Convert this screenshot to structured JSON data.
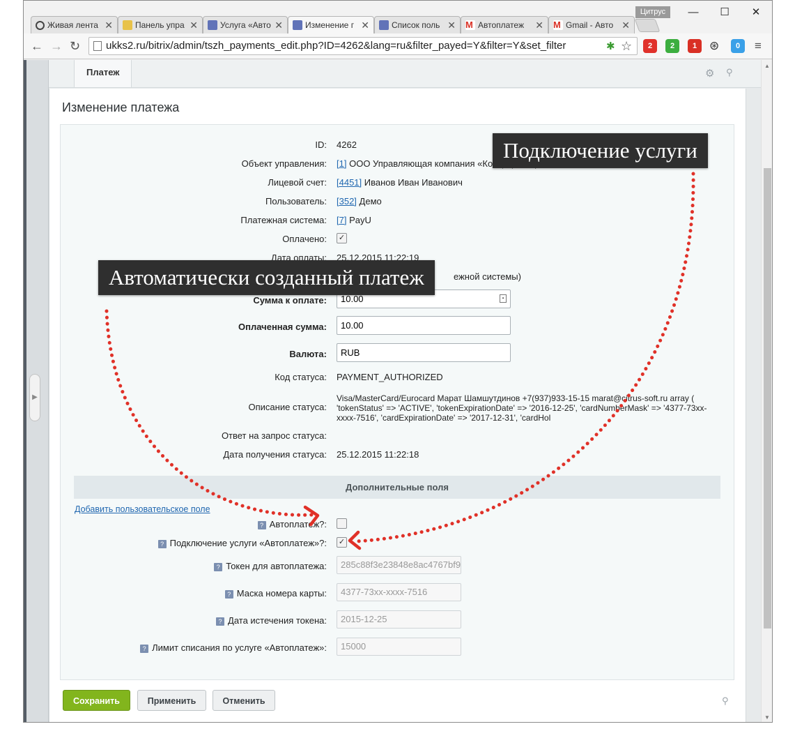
{
  "browser": {
    "profile": "Цитрус",
    "tabs": [
      {
        "label": "Живая лента"
      },
      {
        "label": "Панель упра"
      },
      {
        "label": "Услуга «Авто"
      },
      {
        "label": "Изменение г"
      },
      {
        "label": "Список поль"
      },
      {
        "label": "Автоплатеж"
      },
      {
        "label": "Gmail - Авто"
      }
    ],
    "url": "ukks2.ru/bitrix/admin/tszh_payments_edit.php?ID=4262&lang=ru&filter_payed=Y&filter=Y&set_filter",
    "extensions": [
      {
        "name": "bitrix-icon",
        "badge": "2",
        "color": "#e0312b"
      },
      {
        "name": "evernote-icon",
        "badge": "2",
        "color": "#3cae3f"
      },
      {
        "name": "gmail-icon",
        "badge": "1",
        "color": "#d93025"
      },
      {
        "name": "ghostery-icon",
        "badge": "0",
        "color": "#3aa0e8"
      }
    ]
  },
  "page": {
    "tab_label": "Платеж",
    "title": "Изменение платежа"
  },
  "form": {
    "id": {
      "label": "ID:",
      "value": "4262"
    },
    "object": {
      "label": "Объект управления:",
      "link": "[1]",
      "value": "ООО Управляющая компания «Комфорт Сервис 2»"
    },
    "account": {
      "label": "Лицевой счет:",
      "link": "[4451]",
      "value": "Иванов Иван Иванович"
    },
    "user": {
      "label": "Пользователь:",
      "link": "[352]",
      "value": "Демо"
    },
    "paysystem": {
      "label": "Платежная система:",
      "link": "[7]",
      "value": "PayU"
    },
    "paid": {
      "label": "Оплачено:",
      "checked": true
    },
    "pay_date": {
      "label": "Дата оплаты:",
      "value": "25.12.2015 11:22:19"
    },
    "source_tail": "ежной системы)",
    "sum_to_pay": {
      "label": "Сумма к оплате:",
      "value": "10.00"
    },
    "paid_sum": {
      "label": "Оплаченная сумма:",
      "value": "10.00"
    },
    "currency": {
      "label": "Валюта:",
      "value": "RUB"
    },
    "status_code": {
      "label": "Код статуса:",
      "value": "PAYMENT_AUTHORIZED"
    },
    "status_desc": {
      "label": "Описание статуса:",
      "value": "Visa/MasterCard/Eurocard Марат Шамшутдинов +7(937)933-15-15 marat@citrus-soft.ru array ( 'tokenStatus' => 'ACTIVE', 'tokenExpirationDate' => '2016-12-25', 'cardNumberMask' => '4377-73xx-xxxx-7516', 'cardExpirationDate' => '2017-12-31', 'cardHol"
    },
    "status_response": {
      "label": "Ответ на запрос статуса:"
    },
    "status_date": {
      "label": "Дата получения статуса:",
      "value": "25.12.2015 11:22:18"
    },
    "extra_section": "Дополнительные поля",
    "add_field_link": "Добавить пользовательское поле",
    "autopay": {
      "label": "Автоплатеж?:",
      "checked": false
    },
    "autopay_service": {
      "label": "Подключение услуги «Автоплатеж»?:",
      "checked": true
    },
    "token": {
      "label": "Токен для автоплатежа:",
      "value": "285c88f3e23848e8ac4767bf9"
    },
    "card_mask": {
      "label": "Маска номера карты:",
      "value": "4377-73xx-xxxx-7516"
    },
    "token_expiry": {
      "label": "Дата истечения токена:",
      "value": "2015-12-25"
    },
    "limit": {
      "label": "Лимит списания по услуге «Автоплатеж»:",
      "value": "15000"
    }
  },
  "buttons": {
    "save": "Сохранить",
    "apply": "Применить",
    "cancel": "Отменить"
  },
  "annotations": {
    "service_callout": "Подключение услуги",
    "auto_callout": "Автоматически созданный платеж",
    "arrow_color": "#e03128"
  }
}
